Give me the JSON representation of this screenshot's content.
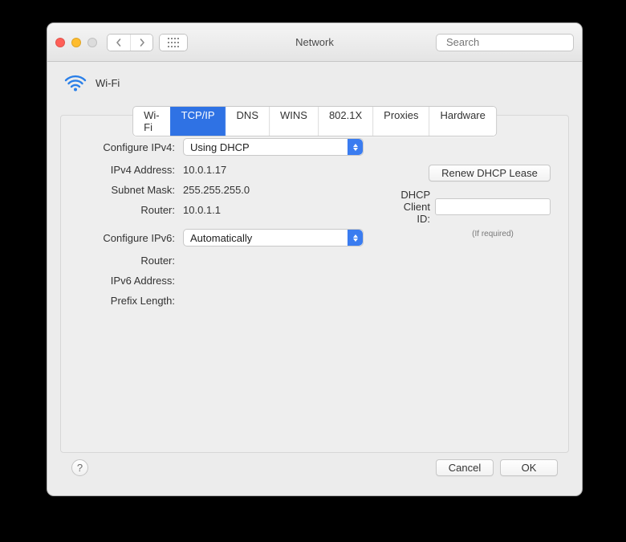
{
  "window": {
    "title": "Network"
  },
  "toolbar": {
    "search_placeholder": "Search"
  },
  "header": {
    "interface_name": "Wi-Fi"
  },
  "tabs": [
    {
      "id": "wifi",
      "label": "Wi-Fi"
    },
    {
      "id": "tcpip",
      "label": "TCP/IP",
      "active": true
    },
    {
      "id": "dns",
      "label": "DNS"
    },
    {
      "id": "wins",
      "label": "WINS"
    },
    {
      "id": "8021x",
      "label": "802.1X"
    },
    {
      "id": "proxies",
      "label": "Proxies"
    },
    {
      "id": "hardware",
      "label": "Hardware"
    }
  ],
  "ipv4": {
    "configure_label": "Configure IPv4:",
    "configure_value": "Using DHCP",
    "address_label": "IPv4 Address:",
    "address_value": "10.0.1.17",
    "subnet_label": "Subnet Mask:",
    "subnet_value": "255.255.255.0",
    "router_label": "Router:",
    "router_value": "10.0.1.1"
  },
  "dhcp": {
    "renew_button": "Renew DHCP Lease",
    "client_id_label": "DHCP Client ID:",
    "client_id_value": "",
    "client_id_hint": "(If required)"
  },
  "ipv6": {
    "configure_label": "Configure IPv6:",
    "configure_value": "Automatically",
    "router_label": "Router:",
    "router_value": "",
    "address_label": "IPv6 Address:",
    "address_value": "",
    "prefix_label": "Prefix Length:",
    "prefix_value": ""
  },
  "footer": {
    "cancel": "Cancel",
    "ok": "OK"
  },
  "colors": {
    "accent": "#2f72e4"
  }
}
